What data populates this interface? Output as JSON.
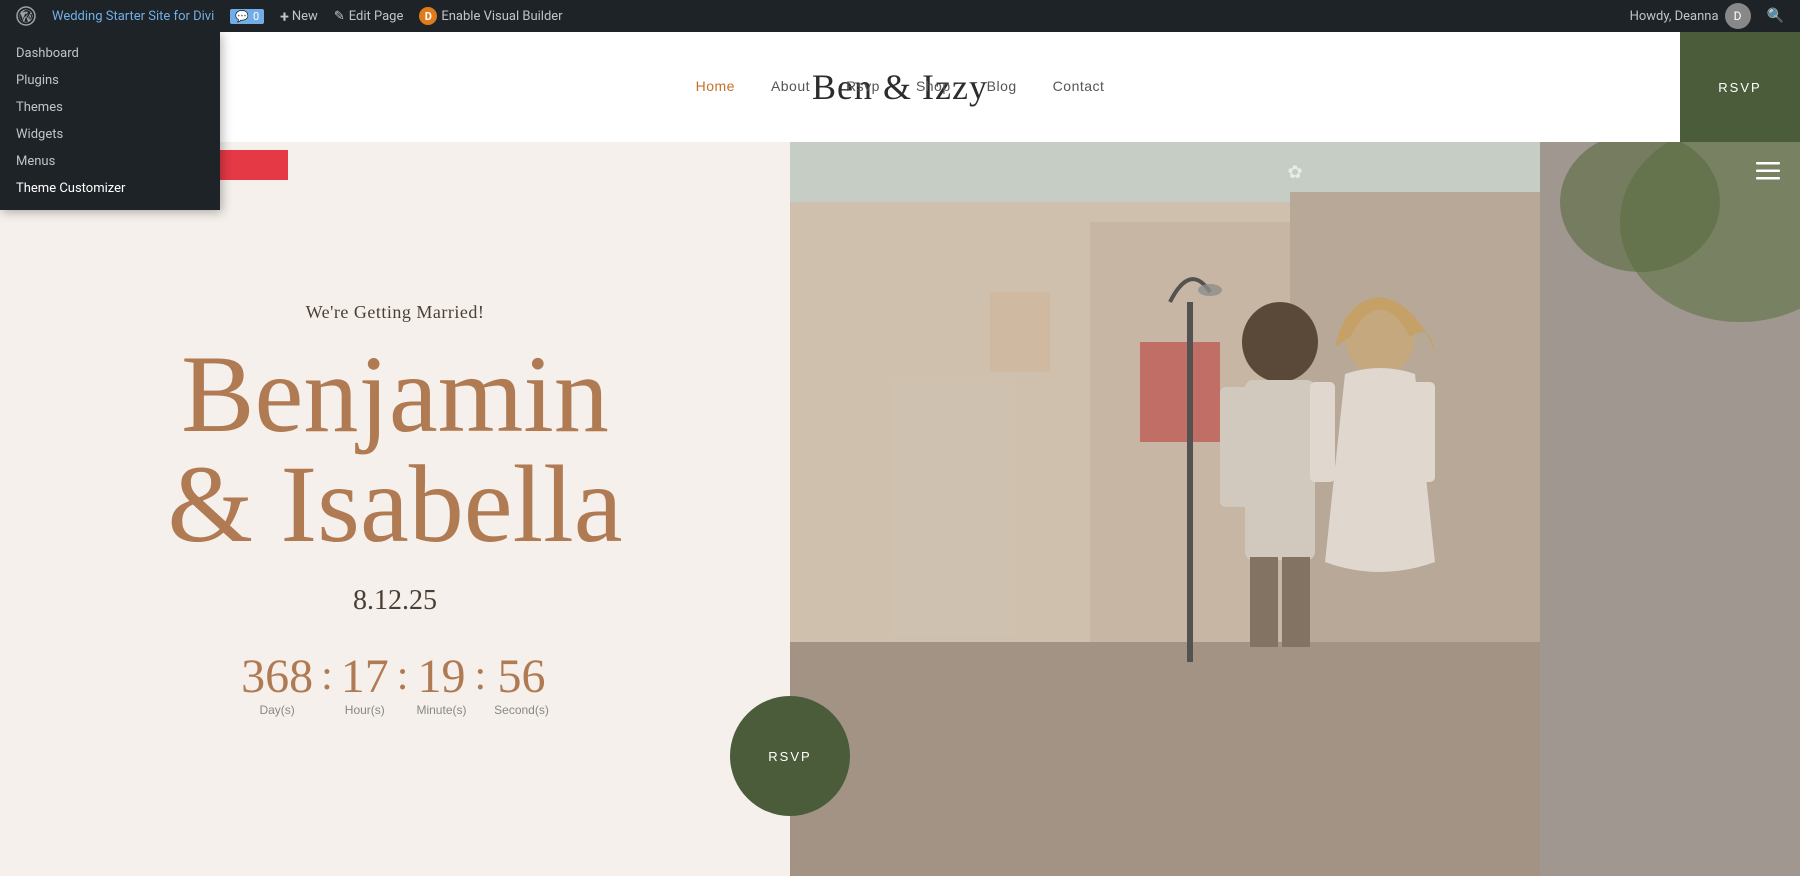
{
  "adminBar": {
    "wpLogo": "⊞",
    "siteName": "Wedding Starter Site for Divi",
    "comments": {
      "icon": "💬",
      "count": "0"
    },
    "newBtn": {
      "icon": "+",
      "label": "New"
    },
    "editPage": {
      "icon": "✎",
      "label": "Edit Page"
    },
    "divi": {
      "icon": "D",
      "label": "Enable Visual Builder"
    },
    "howdy": "Howdy, Deanna",
    "searchIcon": "🔍"
  },
  "dropdown": {
    "items": [
      {
        "id": "dashboard",
        "label": "Dashboard"
      },
      {
        "id": "plugins",
        "label": "Plugins"
      },
      {
        "id": "themes",
        "label": "Themes"
      },
      {
        "id": "widgets",
        "label": "Widgets"
      },
      {
        "id": "menus",
        "label": "Menus"
      },
      {
        "id": "theme-customizer",
        "label": "Theme Customizer",
        "highlighted": true
      }
    ]
  },
  "header": {
    "siteTitle": "Ben & Izzy",
    "nav": [
      {
        "id": "home",
        "label": "Home",
        "active": true
      },
      {
        "id": "about",
        "label": "About"
      },
      {
        "id": "rsvp",
        "label": "Rsvp"
      },
      {
        "id": "shop",
        "label": "Shop"
      },
      {
        "id": "blog",
        "label": "Blog"
      },
      {
        "id": "contact",
        "label": "Contact"
      }
    ],
    "rsvpBtn": "RSVP"
  },
  "hero": {
    "tagline": "We're Getting Married!",
    "name1": "Benjamin",
    "name2": "& Isabella",
    "date": "8.12.25",
    "countdown": {
      "days": {
        "value": "368",
        "label": "Day(s)"
      },
      "hours": {
        "value": "17",
        "label": "Hour(s)"
      },
      "minutes": {
        "value": "19",
        "label": "Minute(s)"
      },
      "seconds": {
        "value": "56",
        "label": "Second(s)"
      }
    },
    "rsvpCircle": "RSVP"
  },
  "arrow": {
    "visible": true
  }
}
